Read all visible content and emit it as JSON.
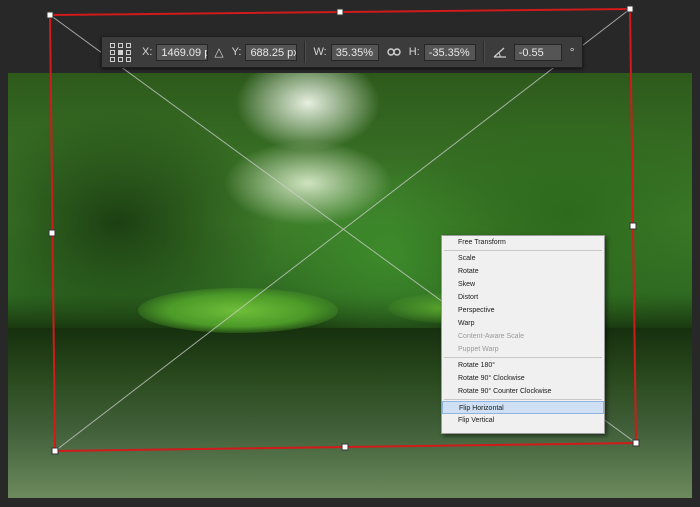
{
  "options_bar": {
    "x_label": "X:",
    "x_value": "1469.09 px",
    "y_label": "Y:",
    "y_value": "688.25 px",
    "w_label": "W:",
    "w_value": "35.35%",
    "h_label": "H:",
    "h_value": "-35.35%",
    "angle_value": "-0.55",
    "angle_unit": "°",
    "delta_symbol": "△"
  },
  "context_menu": {
    "items": [
      {
        "label": "Free Transform"
      },
      {
        "label": "Scale"
      },
      {
        "label": "Rotate"
      },
      {
        "label": "Skew"
      },
      {
        "label": "Distort"
      },
      {
        "label": "Perspective"
      },
      {
        "label": "Warp"
      },
      {
        "label": "Content-Aware Scale",
        "disabled": true
      },
      {
        "label": "Puppet Warp",
        "disabled": true
      },
      {
        "label": "Rotate 180°"
      },
      {
        "label": "Rotate 90° Clockwise"
      },
      {
        "label": "Rotate 90° Counter Clockwise"
      },
      {
        "label": "Flip Horizontal",
        "highlighted": true
      },
      {
        "label": "Flip Vertical"
      }
    ]
  },
  "colors": {
    "transform_border": "#d11a1a",
    "options_bar_bg": "#3c3c3c",
    "menu_highlight": "#cfe0f5",
    "background": "#282828"
  }
}
